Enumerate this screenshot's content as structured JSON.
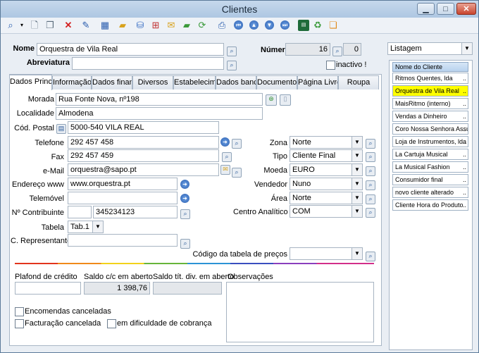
{
  "window": {
    "title": "Clientes",
    "minimize": "▁",
    "maximize": "□",
    "close": "✕"
  },
  "toolbar": {
    "icons": [
      "search-icon",
      "new-document-icon",
      "copy-icon",
      "delete-icon",
      "edit-icon",
      "grid-icon",
      "open-folder-icon",
      "database-icon",
      "network-icon",
      "mail-icon",
      "export-folder-icon",
      "refresh-icon",
      "print-preview-icon",
      "first-record-icon",
      "previous-record-icon",
      "next-record-icon",
      "last-record-icon",
      "calculator-icon",
      "sync-icon",
      "notes-icon"
    ]
  },
  "header": {
    "nome_label": "Nome",
    "nome_value": "Orquestra de Vila Real",
    "abreviatura_label": "Abreviatura",
    "abreviatura_value": "",
    "numero_label": "Número",
    "numero_value": "16",
    "numero_extra": "0",
    "inactivo_label": "inactivo !"
  },
  "tabs": [
    "Dados Princip",
    "Informação",
    "Dados financ",
    "Diversos",
    "Estabelecimer",
    "Dados bancár",
    "Documentos",
    "Página Livre",
    "Roupa"
  ],
  "form": {
    "morada_label": "Morada",
    "morada_value": "Rua Fonte Nova, nº198",
    "localidade_label": "Localidade",
    "localidade_value": "Almodena",
    "cod_postal_label": "Cód. Postal",
    "cod_postal_value": "5000-540 VILA REAL",
    "telefone_label": "Telefone",
    "telefone_value": "292 457 458",
    "fax_label": "Fax",
    "fax_value": "292 457 459",
    "email_label": "e-Mail",
    "email_value": "orquestra@sapo.pt",
    "www_label": "Endereço www",
    "www_value": "www.orquestra.pt",
    "telemovel_label": "Telemóvel",
    "telemovel_value": "",
    "contribuinte_label": "Nº Contribuinte",
    "contribuinte_prefix": "",
    "contribuinte_value": "345234123",
    "tabela_label": "Tabela",
    "tabela_value": "Tab.1",
    "representante_label": "C. Representante",
    "representante_value": "",
    "zona_label": "Zona",
    "zona_value": "Norte",
    "tipo_label": "Tipo",
    "tipo_value": "Cliente Final",
    "moeda_label": "Moeda",
    "moeda_value": "EURO",
    "vendedor_label": "Vendedor",
    "vendedor_value": "Nuno",
    "area_label": "Área",
    "area_value": "Norte",
    "centro_label": "Centro Analítico",
    "centro_value": "COM",
    "codigo_tabela_label": "Código da tabela de preços",
    "codigo_tabela_value": ""
  },
  "financial": {
    "plafond_label": "Plafond de crédito",
    "plafond_value": "",
    "saldo_cc_label": "Saldo c/c em aberto",
    "saldo_cc_value": "1 398,76",
    "saldo_tit_label": "Saldo tít. div. em aberto",
    "saldo_tit_value": "",
    "observacoes_label": "Observações",
    "encomendas_label": "Encomendas canceladas",
    "facturacao_label": "Facturação cancelada",
    "dificuldade_label": "em dificuldade de cobrança"
  },
  "sidebar": {
    "dropdown_value": "Listagem",
    "column_header": "Nome do Cliente",
    "items": [
      "Ritmos Quentes, lda",
      "Orquestra de Vila Real",
      "MaisRitmo (interno)",
      "Vendas a Dinheiro",
      "Coro Nossa Senhora Assunçã",
      "Loja de Instrumentos, lda",
      "La Cartuja Musical",
      "La Musical Fashion",
      "Consumidor final",
      "novo cliente alterado",
      "Cliente Hora do Produto"
    ],
    "selected_index": 1,
    "item_dots": ".."
  },
  "colors": {
    "selected_row": "#ffff00",
    "title_bar": "#b8cfe8",
    "close_button": "#c8452e"
  }
}
